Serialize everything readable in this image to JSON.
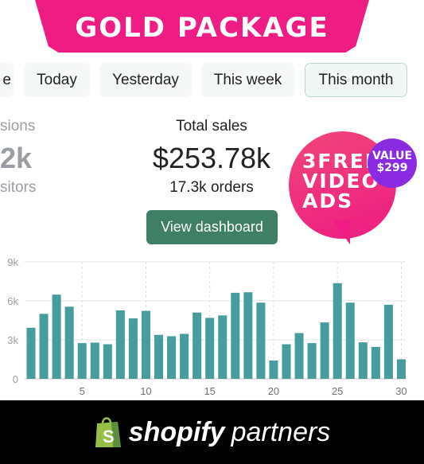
{
  "banner": {
    "title": "GOLD PACKAGE",
    "color": "#ee1c83"
  },
  "filters": [
    {
      "label": "e"
    },
    {
      "label": "Today"
    },
    {
      "label": "Yesterday"
    },
    {
      "label": "This week"
    },
    {
      "label": "This month",
      "active": true
    }
  ],
  "sessions": {
    "label": "sions",
    "value": "2k",
    "sub": "sitors"
  },
  "sales": {
    "label": "Total sales",
    "value": "$253.78k",
    "orders": "17.3k orders",
    "button": "View dashboard"
  },
  "promo": {
    "text_lines": [
      "3FREE",
      "VIDEO",
      "ADS"
    ],
    "badge_lines": [
      "VALUE",
      "$299"
    ]
  },
  "footer": {
    "brand": "shopify",
    "suffix": "partners"
  },
  "chart_data": {
    "type": "bar",
    "x": [
      1,
      2,
      3,
      4,
      5,
      6,
      7,
      8,
      9,
      10,
      11,
      12,
      13,
      14,
      15,
      16,
      17,
      18,
      19,
      20,
      21,
      22,
      23,
      24,
      25,
      26,
      27,
      28,
      29,
      30
    ],
    "values": [
      3930,
      5000,
      6480,
      5550,
      2750,
      2790,
      2660,
      5270,
      4650,
      5230,
      3380,
      3280,
      3460,
      5100,
      4690,
      4880,
      6620,
      6660,
      5860,
      1410,
      2660,
      3520,
      2750,
      4340,
      7360,
      5860,
      2810,
      2460,
      5700,
      1500
    ],
    "ylim": [
      0,
      9000
    ],
    "yticks": [
      "0",
      "3k",
      "6k",
      "9k"
    ],
    "yticks_values": [
      0,
      3000,
      6000,
      9000
    ],
    "xticks": [
      "5",
      "10",
      "15",
      "20",
      "25",
      "30"
    ],
    "xticks_values": [
      5,
      10,
      15,
      20,
      25,
      30
    ],
    "grid": true,
    "color": "#479c9c"
  }
}
